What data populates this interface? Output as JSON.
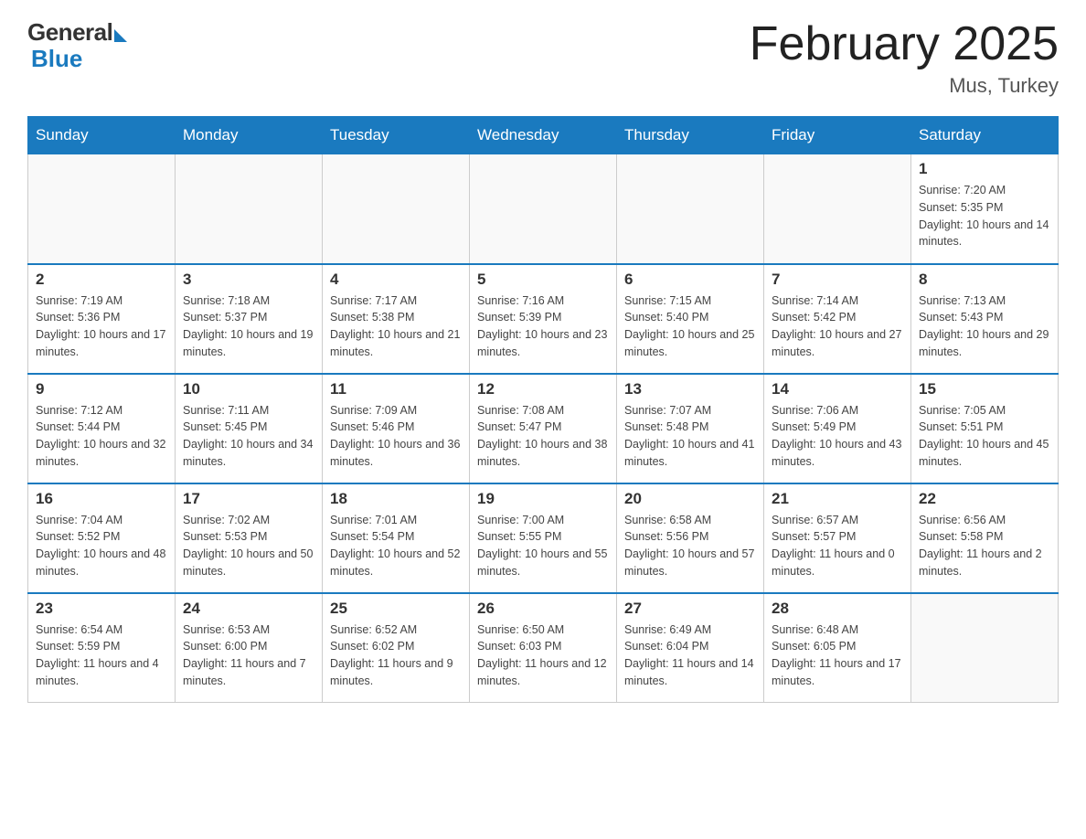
{
  "header": {
    "logo_general": "General",
    "logo_blue": "Blue",
    "month_title": "February 2025",
    "location": "Mus, Turkey"
  },
  "days_of_week": [
    "Sunday",
    "Monday",
    "Tuesday",
    "Wednesday",
    "Thursday",
    "Friday",
    "Saturday"
  ],
  "weeks": [
    [
      {
        "day": "",
        "info": ""
      },
      {
        "day": "",
        "info": ""
      },
      {
        "day": "",
        "info": ""
      },
      {
        "day": "",
        "info": ""
      },
      {
        "day": "",
        "info": ""
      },
      {
        "day": "",
        "info": ""
      },
      {
        "day": "1",
        "info": "Sunrise: 7:20 AM\nSunset: 5:35 PM\nDaylight: 10 hours and 14 minutes."
      }
    ],
    [
      {
        "day": "2",
        "info": "Sunrise: 7:19 AM\nSunset: 5:36 PM\nDaylight: 10 hours and 17 minutes."
      },
      {
        "day": "3",
        "info": "Sunrise: 7:18 AM\nSunset: 5:37 PM\nDaylight: 10 hours and 19 minutes."
      },
      {
        "day": "4",
        "info": "Sunrise: 7:17 AM\nSunset: 5:38 PM\nDaylight: 10 hours and 21 minutes."
      },
      {
        "day": "5",
        "info": "Sunrise: 7:16 AM\nSunset: 5:39 PM\nDaylight: 10 hours and 23 minutes."
      },
      {
        "day": "6",
        "info": "Sunrise: 7:15 AM\nSunset: 5:40 PM\nDaylight: 10 hours and 25 minutes."
      },
      {
        "day": "7",
        "info": "Sunrise: 7:14 AM\nSunset: 5:42 PM\nDaylight: 10 hours and 27 minutes."
      },
      {
        "day": "8",
        "info": "Sunrise: 7:13 AM\nSunset: 5:43 PM\nDaylight: 10 hours and 29 minutes."
      }
    ],
    [
      {
        "day": "9",
        "info": "Sunrise: 7:12 AM\nSunset: 5:44 PM\nDaylight: 10 hours and 32 minutes."
      },
      {
        "day": "10",
        "info": "Sunrise: 7:11 AM\nSunset: 5:45 PM\nDaylight: 10 hours and 34 minutes."
      },
      {
        "day": "11",
        "info": "Sunrise: 7:09 AM\nSunset: 5:46 PM\nDaylight: 10 hours and 36 minutes."
      },
      {
        "day": "12",
        "info": "Sunrise: 7:08 AM\nSunset: 5:47 PM\nDaylight: 10 hours and 38 minutes."
      },
      {
        "day": "13",
        "info": "Sunrise: 7:07 AM\nSunset: 5:48 PM\nDaylight: 10 hours and 41 minutes."
      },
      {
        "day": "14",
        "info": "Sunrise: 7:06 AM\nSunset: 5:49 PM\nDaylight: 10 hours and 43 minutes."
      },
      {
        "day": "15",
        "info": "Sunrise: 7:05 AM\nSunset: 5:51 PM\nDaylight: 10 hours and 45 minutes."
      }
    ],
    [
      {
        "day": "16",
        "info": "Sunrise: 7:04 AM\nSunset: 5:52 PM\nDaylight: 10 hours and 48 minutes."
      },
      {
        "day": "17",
        "info": "Sunrise: 7:02 AM\nSunset: 5:53 PM\nDaylight: 10 hours and 50 minutes."
      },
      {
        "day": "18",
        "info": "Sunrise: 7:01 AM\nSunset: 5:54 PM\nDaylight: 10 hours and 52 minutes."
      },
      {
        "day": "19",
        "info": "Sunrise: 7:00 AM\nSunset: 5:55 PM\nDaylight: 10 hours and 55 minutes."
      },
      {
        "day": "20",
        "info": "Sunrise: 6:58 AM\nSunset: 5:56 PM\nDaylight: 10 hours and 57 minutes."
      },
      {
        "day": "21",
        "info": "Sunrise: 6:57 AM\nSunset: 5:57 PM\nDaylight: 11 hours and 0 minutes."
      },
      {
        "day": "22",
        "info": "Sunrise: 6:56 AM\nSunset: 5:58 PM\nDaylight: 11 hours and 2 minutes."
      }
    ],
    [
      {
        "day": "23",
        "info": "Sunrise: 6:54 AM\nSunset: 5:59 PM\nDaylight: 11 hours and 4 minutes."
      },
      {
        "day": "24",
        "info": "Sunrise: 6:53 AM\nSunset: 6:00 PM\nDaylight: 11 hours and 7 minutes."
      },
      {
        "day": "25",
        "info": "Sunrise: 6:52 AM\nSunset: 6:02 PM\nDaylight: 11 hours and 9 minutes."
      },
      {
        "day": "26",
        "info": "Sunrise: 6:50 AM\nSunset: 6:03 PM\nDaylight: 11 hours and 12 minutes."
      },
      {
        "day": "27",
        "info": "Sunrise: 6:49 AM\nSunset: 6:04 PM\nDaylight: 11 hours and 14 minutes."
      },
      {
        "day": "28",
        "info": "Sunrise: 6:48 AM\nSunset: 6:05 PM\nDaylight: 11 hours and 17 minutes."
      },
      {
        "day": "",
        "info": ""
      }
    ]
  ]
}
